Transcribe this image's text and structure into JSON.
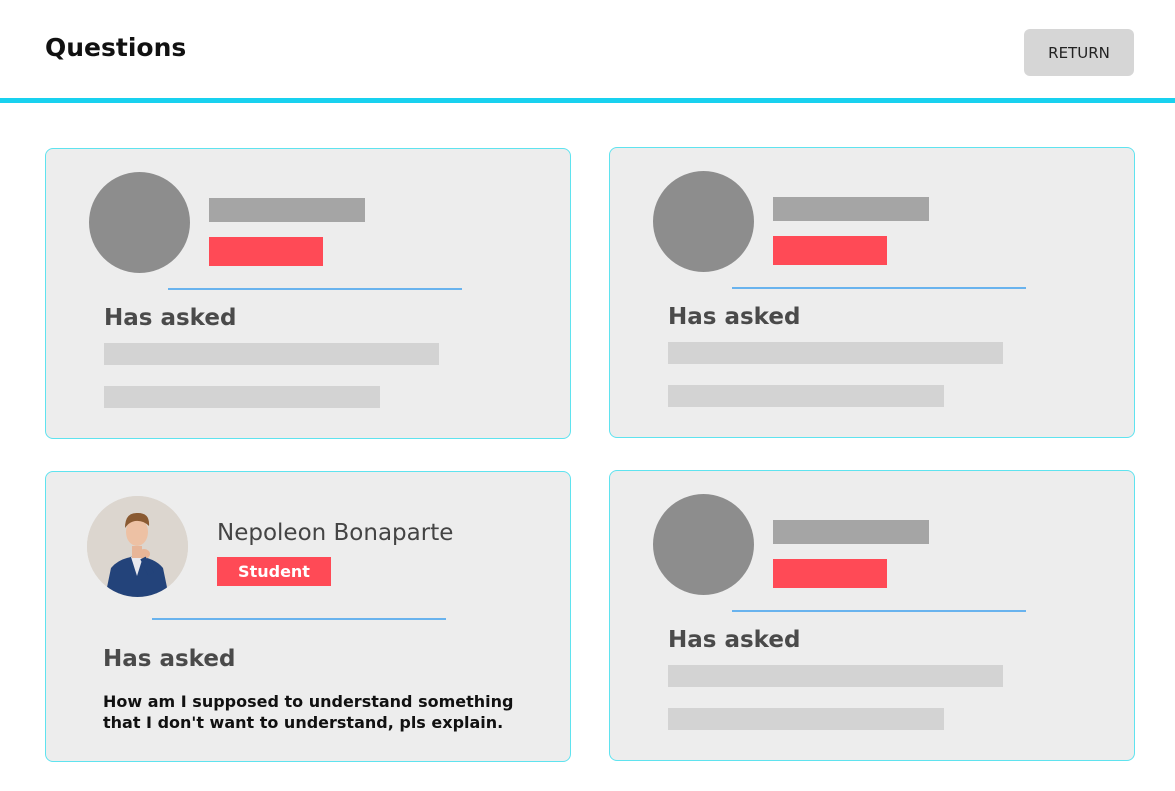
{
  "header": {
    "title": "Questions",
    "return_label": "RETURN"
  },
  "cards": [
    {
      "asked_label": "Has asked"
    },
    {
      "asked_label": "Has asked"
    },
    {
      "asked_label": "Has asked",
      "user_name": "Nepoleon Bonaparte",
      "role": "Student",
      "question": "How am I supposed to understand something that I don't want to understand, pls explain."
    },
    {
      "asked_label": "Has asked"
    }
  ],
  "colors": {
    "accent_rule": "#18d1ef",
    "card_border": "#5fe3ef",
    "role_badge": "#ff4a56",
    "divider": "#69b3ee"
  },
  "icons": {
    "avatar_placeholder": "avatar-placeholder"
  }
}
